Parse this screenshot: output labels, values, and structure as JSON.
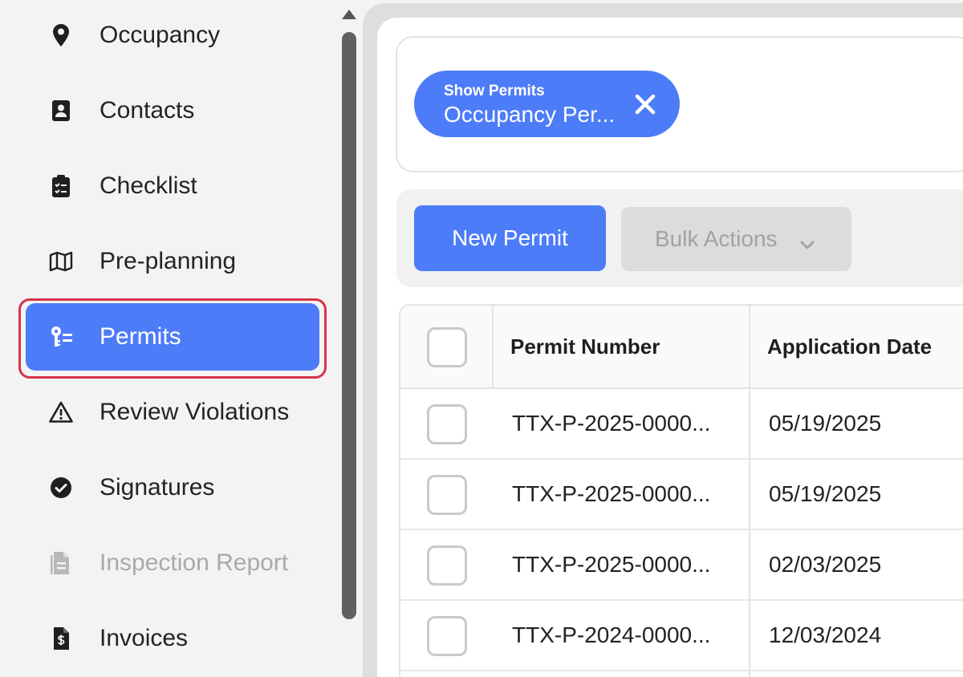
{
  "sidebar": {
    "items": [
      {
        "label": "Occupancy",
        "icon": "map-pin-icon",
        "state": "normal"
      },
      {
        "label": "Contacts",
        "icon": "contact-card-icon",
        "state": "normal"
      },
      {
        "label": "Checklist",
        "icon": "clipboard-checklist-icon",
        "state": "normal"
      },
      {
        "label": "Pre-planning",
        "icon": "map-icon",
        "state": "normal"
      },
      {
        "label": "Permits",
        "icon": "key-list-icon",
        "state": "active"
      },
      {
        "label": "Review Violations",
        "icon": "warning-triangle-icon",
        "state": "normal"
      },
      {
        "label": "Signatures",
        "icon": "check-circle-icon",
        "state": "normal"
      },
      {
        "label": "Inspection Report",
        "icon": "document-icon",
        "state": "disabled"
      },
      {
        "label": "Invoices",
        "icon": "invoice-dollar-icon",
        "state": "normal"
      }
    ]
  },
  "filter": {
    "chip": {
      "caption": "Show Permits",
      "value": "Occupancy Per...",
      "close_icon": "close-icon"
    }
  },
  "toolbar": {
    "new_permit_label": "New Permit",
    "bulk_actions_label": "Bulk Actions",
    "bulk_actions_icon": "chevron-down-icon"
  },
  "table": {
    "columns": [
      "Permit Number",
      "Application Date"
    ],
    "rows": [
      {
        "permit_number": "TTX-P-2025-0000...",
        "application_date": "05/19/2025"
      },
      {
        "permit_number": "TTX-P-2025-0000...",
        "application_date": "05/19/2025"
      },
      {
        "permit_number": "TTX-P-2025-0000...",
        "application_date": "02/03/2025"
      },
      {
        "permit_number": "TTX-P-2024-0000...",
        "application_date": "12/03/2024"
      }
    ]
  },
  "colors": {
    "accent": "#4d7cf8",
    "highlight_outline": "#d8334a",
    "disabled_text": "#a9a9a9"
  }
}
